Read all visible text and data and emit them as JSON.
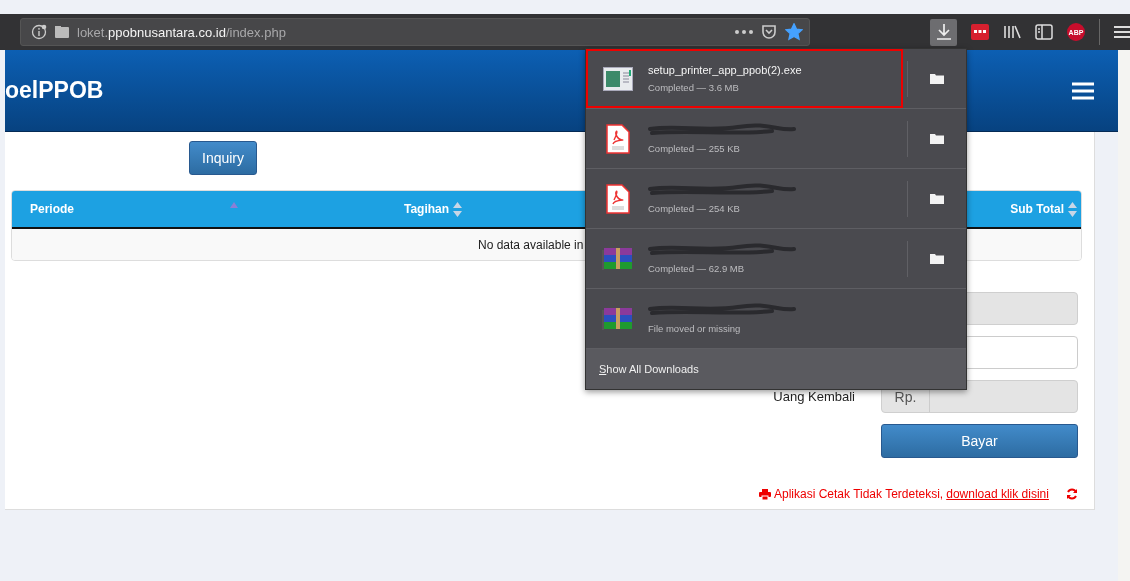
{
  "browser": {
    "url_prefix": "loket.",
    "url_domain": "ppobnusantara.co.id",
    "url_path": "/index.php",
    "bookmarked": true,
    "downloads_open": true,
    "adblock_label": "ABP"
  },
  "header": {
    "brand": "oelPPOB"
  },
  "inquiry_button": "Inquiry",
  "table": {
    "columns": [
      {
        "label": "Periode",
        "sorted": true
      },
      {
        "label": "Tagihan",
        "sorted": false
      },
      {
        "label": "Sub Total",
        "sorted": false
      }
    ],
    "empty_message": "No data available in"
  },
  "form": {
    "fields": [
      {
        "disabled": true
      },
      {
        "disabled": false
      },
      {
        "label": "Uang Kembali",
        "addon": "Rp.",
        "disabled": true
      }
    ],
    "submit": "Bayar",
    "alert": "Aplikasi Cetak Tidak Terdeteksi,",
    "alert_link": "download klik disini"
  },
  "downloads": {
    "items": [
      {
        "kind": "exe",
        "name": "setup_printer_app_ppob(2).exe",
        "status": "Completed — 3.6 MB",
        "selected": true,
        "folder": true,
        "redacted": false
      },
      {
        "kind": "pdf",
        "status": "Completed — 255 KB",
        "selected": false,
        "folder": true,
        "redacted": true
      },
      {
        "kind": "pdf",
        "status": "Completed — 254 KB",
        "selected": false,
        "folder": true,
        "redacted": true
      },
      {
        "kind": "archive",
        "status": "Completed — 62.9 MB",
        "selected": false,
        "folder": true,
        "redacted": true
      },
      {
        "kind": "archive",
        "status": "File moved or missing",
        "selected": false,
        "folder": false,
        "redacted": true
      }
    ],
    "show_all": "Show All Downloads"
  }
}
